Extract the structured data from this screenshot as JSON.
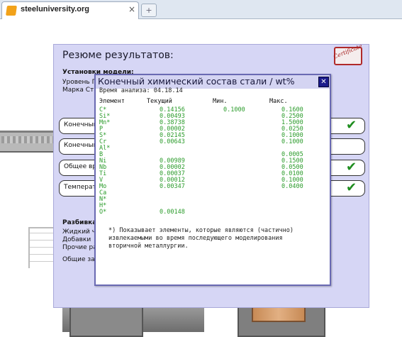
{
  "browser": {
    "tab_title": "steeluniversity.org",
    "tab_close": "×",
    "newtab": "+"
  },
  "panel": {
    "title": "Резюме результатов:",
    "certificate": "Certificate",
    "model_settings": {
      "heading": "Установки модели:",
      "row1": "Уровень П",
      "row2": "Марка Ста"
    },
    "results": [
      {
        "label": "Конечный",
        "check": true
      },
      {
        "label": "Конечный",
        "check": false
      },
      {
        "label": "Общее вр",
        "check": true
      },
      {
        "label": "Температу",
        "check": true
      }
    ],
    "check_glyph": "✔",
    "breakdown": {
      "heading": "Разбивка",
      "rows": [
        "Жидкий чу",
        "Добавки",
        "Прочие ра",
        "",
        "Общие зат"
      ]
    }
  },
  "chem": {
    "title": "Конечный химический состав стали / wt%",
    "close": "✕",
    "analysis_time": "Время анализа: 04.18.14",
    "headers": {
      "element": "Элемент",
      "current": "Текущий",
      "min": "Мин.",
      "max": "Макс."
    },
    "rows": [
      {
        "el": "C*",
        "cur": "0.14156",
        "min": "0.1000",
        "max": "0.1600"
      },
      {
        "el": "Si*",
        "cur": "0.00493",
        "min": "",
        "max": "0.2500"
      },
      {
        "el": "Mn*",
        "cur": "0.38738",
        "min": "",
        "max": "1.5000"
      },
      {
        "el": "P",
        "cur": "0.00002",
        "min": "",
        "max": "0.0250"
      },
      {
        "el": "S*",
        "cur": "0.02145",
        "min": "",
        "max": "0.1000"
      },
      {
        "el": "Cr",
        "cur": "0.00643",
        "min": "",
        "max": "0.1000"
      },
      {
        "el": "Al*",
        "cur": "",
        "min": "",
        "max": ""
      },
      {
        "el": "B",
        "cur": "",
        "min": "",
        "max": "0.0005"
      },
      {
        "el": "Ni",
        "cur": "0.00989",
        "min": "",
        "max": "0.1500"
      },
      {
        "el": "Nb",
        "cur": "0.00002",
        "min": "",
        "max": "0.0500"
      },
      {
        "el": "Ti",
        "cur": "0.00037",
        "min": "",
        "max": "0.0100"
      },
      {
        "el": "V",
        "cur": "0.00012",
        "min": "",
        "max": "0.1000"
      },
      {
        "el": "Mo",
        "cur": "0.00347",
        "min": "",
        "max": "0.0400"
      },
      {
        "el": "Ca",
        "cur": "",
        "min": "",
        "max": ""
      },
      {
        "el": "N*",
        "cur": "",
        "min": "",
        "max": ""
      },
      {
        "el": "H*",
        "cur": "",
        "min": "",
        "max": ""
      },
      {
        "el": "O*",
        "cur": "0.00148",
        "min": "",
        "max": ""
      }
    ],
    "note_lines": [
      "*) Показывает элементы, которые являются (частично)",
      "извлекаемыми во время последующего моделирования",
      "вторичной металлургии."
    ]
  },
  "colors": {
    "panel": "#d6d6f5",
    "value_green": "#2a9b2a",
    "check_green": "#1e8d1e",
    "title_bar": "#d4d4f2",
    "close_button": "#1c1c8c"
  }
}
